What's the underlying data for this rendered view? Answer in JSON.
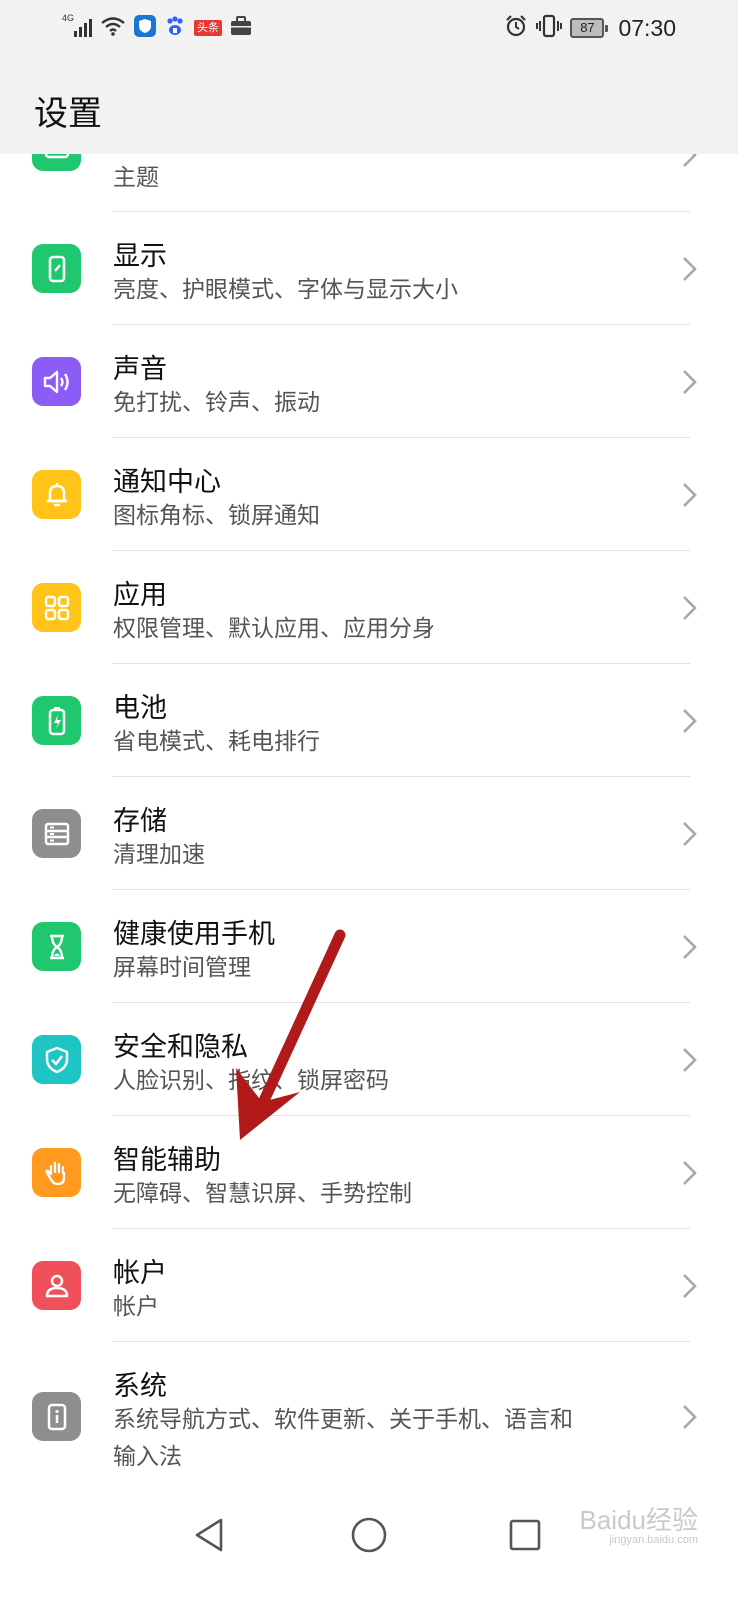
{
  "status_bar": {
    "network": "4G",
    "news_badge": "头条",
    "battery": "87",
    "time": "07:30"
  },
  "header": {
    "title": "设置"
  },
  "settings": [
    {
      "id": "theme",
      "title": "",
      "subtitle": "主题",
      "icon": "theme-icon",
      "color": "#1fc86e"
    },
    {
      "id": "display",
      "title": "显示",
      "subtitle": "亮度、护眼模式、字体与显示大小",
      "icon": "display-icon",
      "color": "#1fc86e"
    },
    {
      "id": "sound",
      "title": "声音",
      "subtitle": "免打扰、铃声、振动",
      "icon": "sound-icon",
      "color": "#8b5cf6"
    },
    {
      "id": "notifications",
      "title": "通知中心",
      "subtitle": "图标角标、锁屏通知",
      "icon": "bell-icon",
      "color": "#ffc31a"
    },
    {
      "id": "apps",
      "title": "应用",
      "subtitle": "权限管理、默认应用、应用分身",
      "icon": "apps-grid-icon",
      "color": "#ffc31a"
    },
    {
      "id": "battery",
      "title": "电池",
      "subtitle": "省电模式、耗电排行",
      "icon": "battery-icon",
      "color": "#1fc86e"
    },
    {
      "id": "storage",
      "title": "存储",
      "subtitle": "清理加速",
      "icon": "storage-icon",
      "color": "#8e8e8e"
    },
    {
      "id": "digital-balance",
      "title": "健康使用手机",
      "subtitle": "屏幕时间管理",
      "icon": "hourglass-icon",
      "color": "#1fc86e"
    },
    {
      "id": "security",
      "title": "安全和隐私",
      "subtitle": "人脸识别、指纹、锁屏密码",
      "icon": "shield-check-icon",
      "color": "#1fc5c5"
    },
    {
      "id": "accessibility",
      "title": "智能辅助",
      "subtitle": "无障碍、智慧识屏、手势控制",
      "icon": "hand-icon",
      "color": "#ff9a1f"
    },
    {
      "id": "account",
      "title": "帐户",
      "subtitle": "帐户",
      "icon": "user-icon",
      "color": "#f0505a"
    },
    {
      "id": "system",
      "title": "系统",
      "subtitle": "系统导航方式、软件更新、关于手机、语言和",
      "subtitle2": "输入法",
      "icon": "system-info-icon",
      "color": "#8e8e8e"
    }
  ],
  "watermark": {
    "main": "Baidu经验",
    "sub": "jingyan.baidu.com"
  }
}
